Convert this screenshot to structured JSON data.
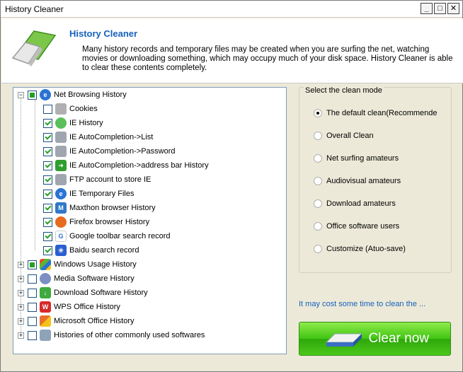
{
  "window": {
    "title": "History Cleaner",
    "minimize": "_",
    "maximize": "□",
    "close": "✕"
  },
  "header": {
    "title": "History Cleaner",
    "description": "Many history records and temporary files may be created when you are surfing the net, watching movies or downloading something, which may occupy much of your disk space. History Cleaner is able to clear these contents completely."
  },
  "tree": {
    "root": {
      "label": "Net Browsing History",
      "icon": "ie-globe-icon",
      "state": "partial"
    },
    "children": [
      {
        "label": "Cookies",
        "icon": "cookie-icon",
        "checked": false
      },
      {
        "label": "IE History",
        "icon": "history-icon",
        "checked": true
      },
      {
        "label": "IE AutoCompletion->List",
        "icon": "user-icon",
        "checked": true
      },
      {
        "label": "IE AutoCompletion->Password",
        "icon": "user-icon",
        "checked": true
      },
      {
        "label": "IE AutoCompletion->address bar History",
        "icon": "green-arrow-icon",
        "checked": true
      },
      {
        "label": "FTP account to store IE",
        "icon": "user-icon",
        "checked": true
      },
      {
        "label": "IE Temporary Files",
        "icon": "ie-icon",
        "checked": true
      },
      {
        "label": "Maxthon browser  History",
        "icon": "maxthon-icon",
        "checked": true
      },
      {
        "label": "Firefox browser History",
        "icon": "firefox-icon",
        "checked": true
      },
      {
        "label": "Google toolbar search record",
        "icon": "google-icon",
        "checked": true
      },
      {
        "label": "Baidu search record",
        "icon": "baidu-icon",
        "checked": true
      }
    ],
    "groups": [
      {
        "label": "Windows Usage History",
        "icon": "windows-icon",
        "state": "partial"
      },
      {
        "label": "Media Software History",
        "icon": "media-icon",
        "state": "unchecked"
      },
      {
        "label": "Download Software History",
        "icon": "download-icon",
        "state": "unchecked"
      },
      {
        "label": "WPS Office History",
        "icon": "wps-icon",
        "state": "unchecked"
      },
      {
        "label": "Microsoft Office History",
        "icon": "office-icon",
        "state": "unchecked"
      },
      {
        "label": "Histories of other commonly used softwares",
        "icon": "software-icon",
        "state": "unchecked"
      }
    ]
  },
  "mode": {
    "legend": "Select the clean mode",
    "options": [
      {
        "label": "The default clean(Recommende",
        "selected": true
      },
      {
        "label": "Overall Clean",
        "selected": false
      },
      {
        "label": "Net surfing amateurs",
        "selected": false
      },
      {
        "label": "Audiovisual amateurs",
        "selected": false
      },
      {
        "label": "Download amateurs",
        "selected": false
      },
      {
        "label": "Office software users",
        "selected": false
      },
      {
        "label": "Customize (Atuo-save)",
        "selected": false
      }
    ]
  },
  "cost_note": "It may cost some time to clean the ...",
  "clean_button": "Clear now",
  "colors": {
    "accent": "#1560bd",
    "check": "#21a121",
    "button": "#3fc512"
  }
}
